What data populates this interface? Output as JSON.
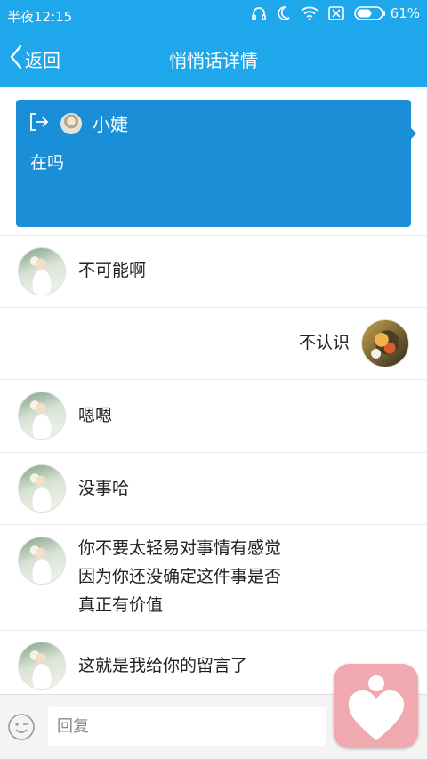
{
  "status_bar": {
    "time": "半夜12:15",
    "battery": "61%",
    "battery_level": 0.61,
    "icons": [
      "headphones-icon",
      "moon-icon",
      "wifi-icon",
      "sim-off-icon",
      "battery-icon"
    ]
  },
  "header": {
    "back_label": "返回",
    "title": "悄悄话详情"
  },
  "original_message": {
    "sender": "小婕",
    "text": "在吗",
    "icons": [
      "reply-arrow-icon"
    ]
  },
  "messages": [
    {
      "side": "left",
      "text": "不可能啊"
    },
    {
      "side": "right",
      "text": "不认识"
    },
    {
      "side": "left",
      "text": "嗯嗯"
    },
    {
      "side": "left",
      "text": "没事哈"
    },
    {
      "side": "left",
      "lines": [
        "你不要太轻易对事情有感觉",
        "因为你还没确定这件事是否",
        "真正有价值"
      ]
    },
    {
      "side": "left",
      "text": "这就是我给你的留言了"
    }
  ],
  "reply_bar": {
    "placeholder": "回复",
    "value": ""
  },
  "colors": {
    "accent": "#1ea7ea",
    "card": "#1a8fd8",
    "float_app": "#f0a9ae"
  }
}
